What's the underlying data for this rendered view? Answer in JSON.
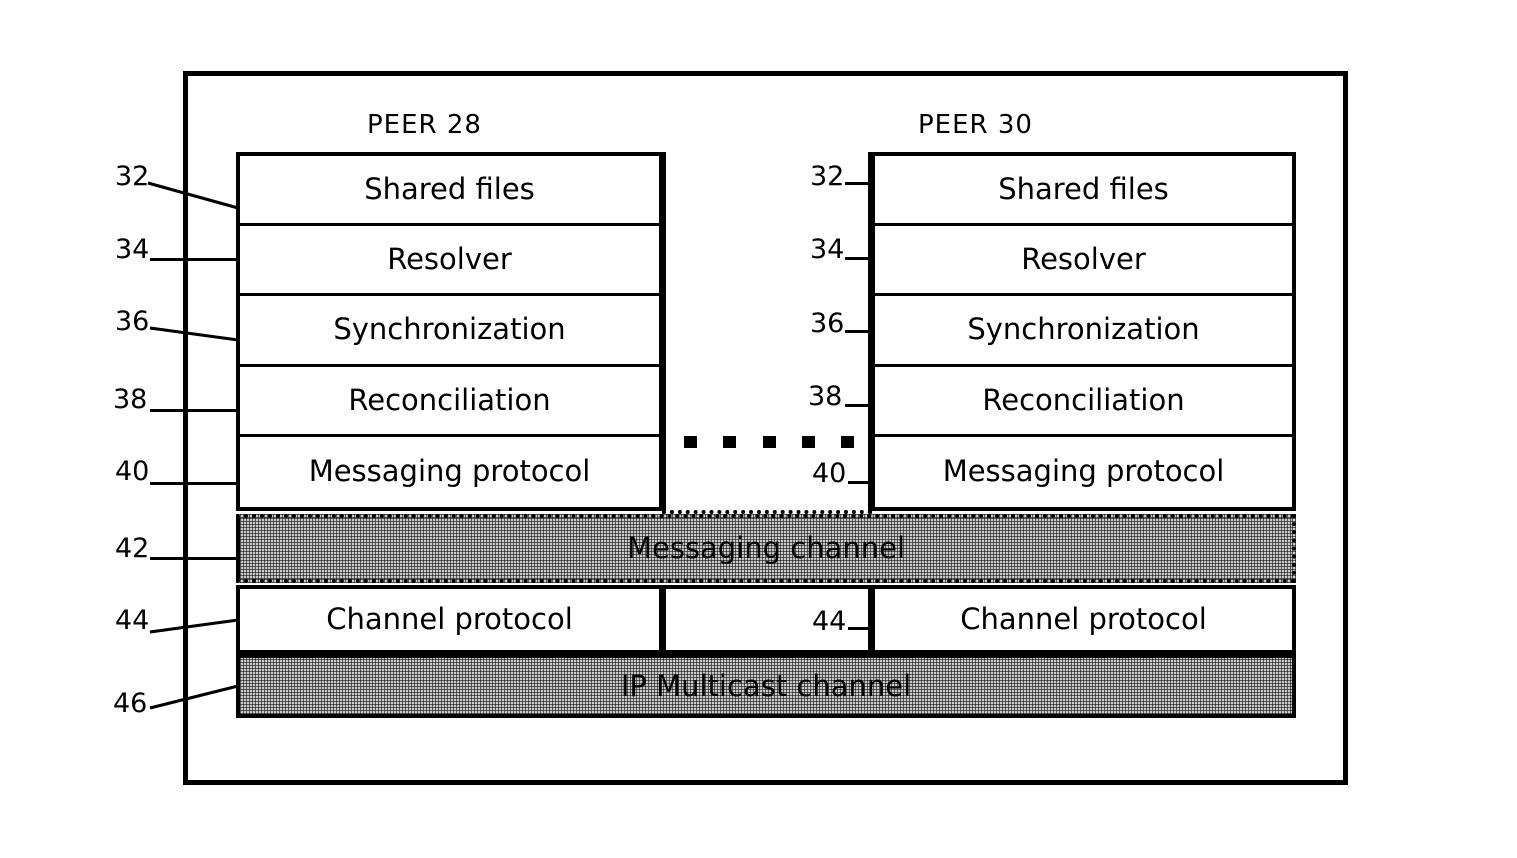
{
  "figure": {
    "type": "patent-block-diagram",
    "peers": [
      {
        "id": "peer-left",
        "title": "PEER 28",
        "layers": [
          {
            "ref": "32",
            "label": "Shared files"
          },
          {
            "ref": "34",
            "label": "Resolver"
          },
          {
            "ref": "36",
            "label": "Synchronization"
          },
          {
            "ref": "38",
            "label": "Reconciliation"
          },
          {
            "ref": "40",
            "label": "Messaging protocol"
          }
        ],
        "channel_protocol": {
          "ref": "44",
          "label": "Channel protocol"
        }
      },
      {
        "id": "peer-right",
        "title": "PEER 30",
        "layers": [
          {
            "ref": "32",
            "label": "Shared files"
          },
          {
            "ref": "34",
            "label": "Resolver"
          },
          {
            "ref": "36",
            "label": "Synchronization"
          },
          {
            "ref": "38",
            "label": "Reconciliation"
          },
          {
            "ref": "40",
            "label": "Messaging protocol"
          }
        ],
        "channel_protocol": {
          "ref": "44",
          "label": "Channel protocol"
        }
      }
    ],
    "shared_channels": [
      {
        "ref": "42",
        "label": "Messaging channel",
        "style": "dotted-border-shaded"
      },
      {
        "ref": "46",
        "label": "IP Multicast channel",
        "style": "solid-border-shaded"
      }
    ],
    "ellipsis_dot_count": 5,
    "colors": {
      "line": "#000000",
      "background": "#ffffff",
      "channel_fill": "#c9c9c9"
    }
  }
}
